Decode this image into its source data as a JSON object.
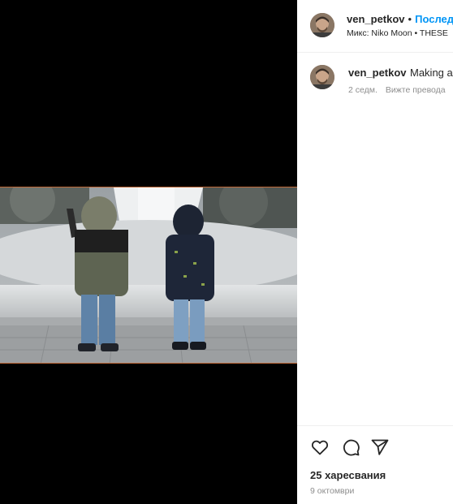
{
  "post": {
    "username": "ven_petkov",
    "separator": "•",
    "follow_label": "Последва",
    "audio_prefix": "Микс:",
    "audio_text": "Niko Moon • THESE"
  },
  "caption": {
    "username": "ven_petkov",
    "text": "Making a",
    "age": "2 седм.",
    "see_translation": "Вижте превода"
  },
  "footer": {
    "likes": "25 харесвания",
    "date": "9 октомври"
  },
  "icons": {
    "like": "heart-icon",
    "comment": "comment-icon",
    "share": "send-icon"
  },
  "colors": {
    "accent": "#0095f6",
    "text": "#262626",
    "secondary": "#8e8e8e",
    "media_bg": "#000000"
  }
}
